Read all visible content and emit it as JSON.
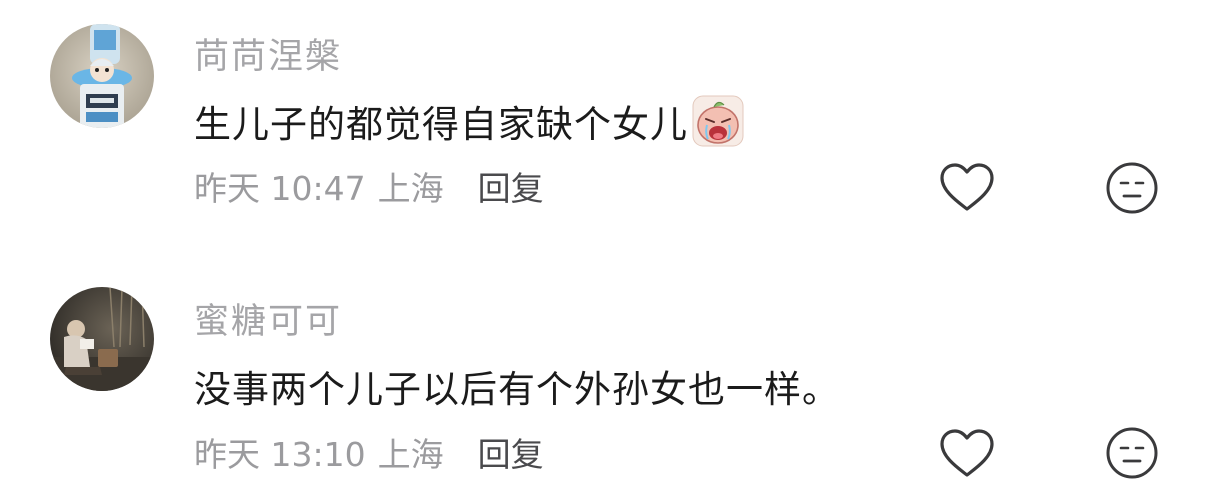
{
  "comments": [
    {
      "username": "苘苘涅槃",
      "text": "生儿子的都觉得自家缺个女儿",
      "sticker": "crying-face-sticker",
      "time": "昨天 10:47",
      "location": "上海",
      "reply_label": "回复",
      "avatar": "avatar-figurine-on-bottle"
    },
    {
      "username": "蜜糖可可",
      "text": "没事两个儿子以后有个外孙女也一样。",
      "time": "昨天 13:10",
      "location": "上海",
      "reply_label": "回复",
      "avatar": "avatar-person-reading-outdoors"
    }
  ],
  "icons": {
    "like": "heart-outline-icon",
    "dislike": "neutral-face-icon"
  },
  "colors": {
    "username": "#a5a5a8",
    "text": "#1b1b1b",
    "meta": "#9b9b9e",
    "reply": "#4a4a4d",
    "icon_stroke": "#3a3a3c"
  }
}
